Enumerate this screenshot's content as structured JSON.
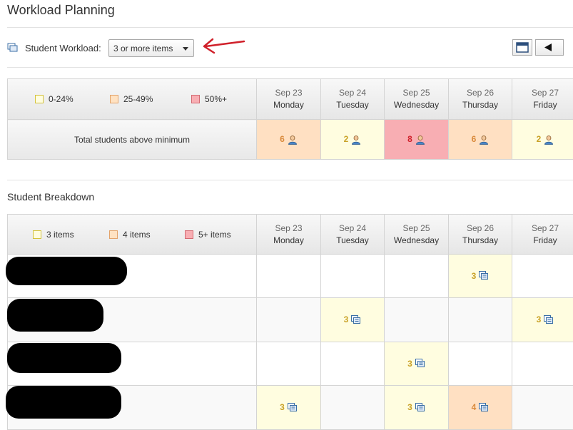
{
  "page": {
    "title": "Workload Planning"
  },
  "toolbar": {
    "workload_label": "Student Workload:",
    "workload_value": "3 or more items",
    "view_icon": "calendar-icon",
    "prev_icon": "triangle-left-icon"
  },
  "summary": {
    "legend": [
      {
        "label": "0-24%",
        "color": "#fffde0"
      },
      {
        "label": "25-49%",
        "color": "#ffe2c2"
      },
      {
        "label": "50%+",
        "color": "#f8aeb3"
      }
    ],
    "days": [
      {
        "date": "Sep 23",
        "day": "Monday"
      },
      {
        "date": "Sep 24",
        "day": "Tuesday"
      },
      {
        "date": "Sep 25",
        "day": "Wednesday"
      },
      {
        "date": "Sep 26",
        "day": "Thursday"
      },
      {
        "date": "Sep 27",
        "day": "Friday"
      }
    ],
    "total_label": "Total students above minimum",
    "totals": [
      "6",
      "2",
      "8",
      "6",
      "2"
    ]
  },
  "breakdown": {
    "title": "Student Breakdown",
    "legend": [
      {
        "label": "3 items",
        "color": "#fffde0"
      },
      {
        "label": "4 items",
        "color": "#ffe2c2"
      },
      {
        "label": "5+ items",
        "color": "#f8aeb3"
      }
    ],
    "days": [
      {
        "date": "Sep 23",
        "day": "Monday"
      },
      {
        "date": "Sep 24",
        "day": "Tuesday"
      },
      {
        "date": "Sep 25",
        "day": "Wednesday"
      },
      {
        "date": "Sep 26",
        "day": "Thursday"
      },
      {
        "date": "Sep 27",
        "day": "Friday"
      }
    ],
    "rows": [
      {
        "cells": [
          "",
          "",
          "",
          "3",
          ""
        ]
      },
      {
        "cells": [
          "",
          "3",
          "",
          "",
          "3"
        ]
      },
      {
        "cells": [
          "",
          "",
          "3",
          "",
          ""
        ]
      },
      {
        "cells": [
          "3",
          "",
          "3",
          "4",
          ""
        ]
      }
    ]
  },
  "colors": {
    "yellow": "#fffde0",
    "orange": "#ffe0c2",
    "red": "#f8aeb3",
    "annotation_arrow": "#d0202a"
  }
}
